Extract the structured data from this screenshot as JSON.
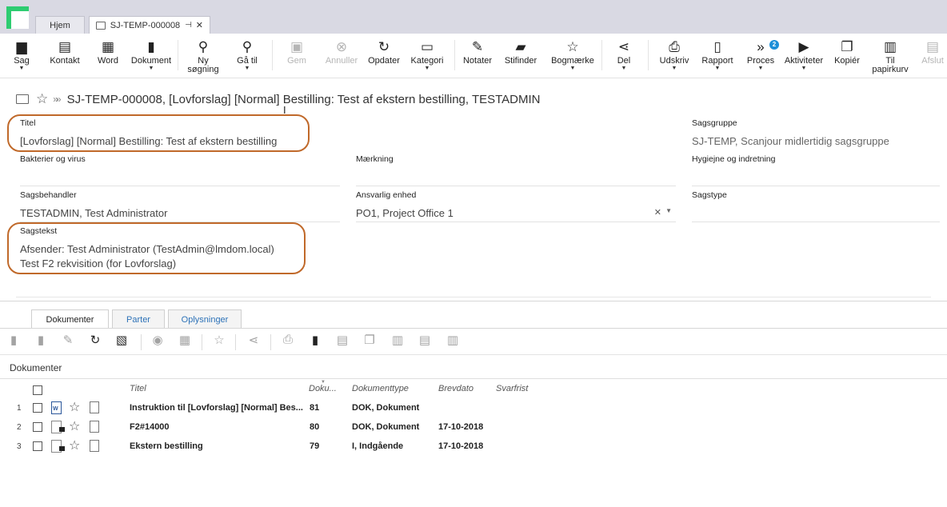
{
  "tabs": [
    {
      "label": "Hjem"
    },
    {
      "label": "SJ-TEMP-000008,..."
    }
  ],
  "toolbar": {
    "sag": "Sag",
    "kontakt": "Kontakt",
    "word": "Word",
    "dokument": "Dokument",
    "ny_sogning_1": "Ny",
    "ny_sogning_2": "søgning",
    "ga_til": "Gå til",
    "gem": "Gem",
    "annuller": "Annuller",
    "opdater": "Opdater",
    "kategori": "Kategori",
    "notater": "Notater",
    "stifinder": "Stifinder",
    "bogmaerke": "Bogmærke",
    "del": "Del",
    "udskriv": "Udskriv",
    "rapport": "Rapport",
    "proces": "Proces",
    "proces_badge": "2",
    "aktiviteter": "Aktiviteter",
    "kopier": "Kopiér",
    "til_papirkurv_1": "Til",
    "til_papirkurv_2": "papirkurv",
    "afslut": "Afslut"
  },
  "case_title": "SJ-TEMP-000008, [Lovforslag] [Normal] Bestilling: Test af ekstern bestilling, TESTADMIN",
  "fields": {
    "titel": {
      "label": "Titel",
      "value": "[Lovforslag] [Normal] Bestilling: Test af ekstern bestilling"
    },
    "sagsgruppe": {
      "label": "Sagsgruppe",
      "value": "SJ-TEMP, Scanjour midlertidig sagsgruppe"
    },
    "bakterier": {
      "label": "Bakterier og virus",
      "value": ""
    },
    "maerkning": {
      "label": "Mærkning",
      "value": ""
    },
    "hygiejne": {
      "label": "Hygiejne og indretning",
      "value": ""
    },
    "sagsbehandler": {
      "label": "Sagsbehandler",
      "value": "TESTADMIN, Test Administrator"
    },
    "ansvarlig": {
      "label": "Ansvarlig enhed",
      "value": "PO1, Project Office 1"
    },
    "sagstype": {
      "label": "Sagstype",
      "value": ""
    },
    "sagstekst": {
      "label": "Sagstekst",
      "line1": "Afsender: Test Administrator (TestAdmin@lmdom.local)",
      "line2": "Test F2 rekvisition (for Lovforslag)"
    }
  },
  "lower_tabs": [
    {
      "label": "Dokumenter"
    },
    {
      "label": "Parter"
    },
    {
      "label": "Oplysninger"
    }
  ],
  "section_title": "Dokumenter",
  "table": {
    "headers": [
      "Titel",
      "Doku...",
      "Dokumenttype",
      "Brevdato",
      "Svarfrist"
    ],
    "rows": [
      {
        "n": "1",
        "titel": "Instruktion til [Lovforslag] [Normal] Bes...",
        "nr": "81",
        "type": "DOK, Dokument",
        "dato": ""
      },
      {
        "n": "2",
        "titel": "F2#14000",
        "nr": "80",
        "type": "DOK, Dokument",
        "dato": "17-10-2018"
      },
      {
        "n": "3",
        "titel": "Ekstern bestilling",
        "nr": "79",
        "type": "I, Indgående",
        "dato": "17-10-2018"
      }
    ]
  }
}
